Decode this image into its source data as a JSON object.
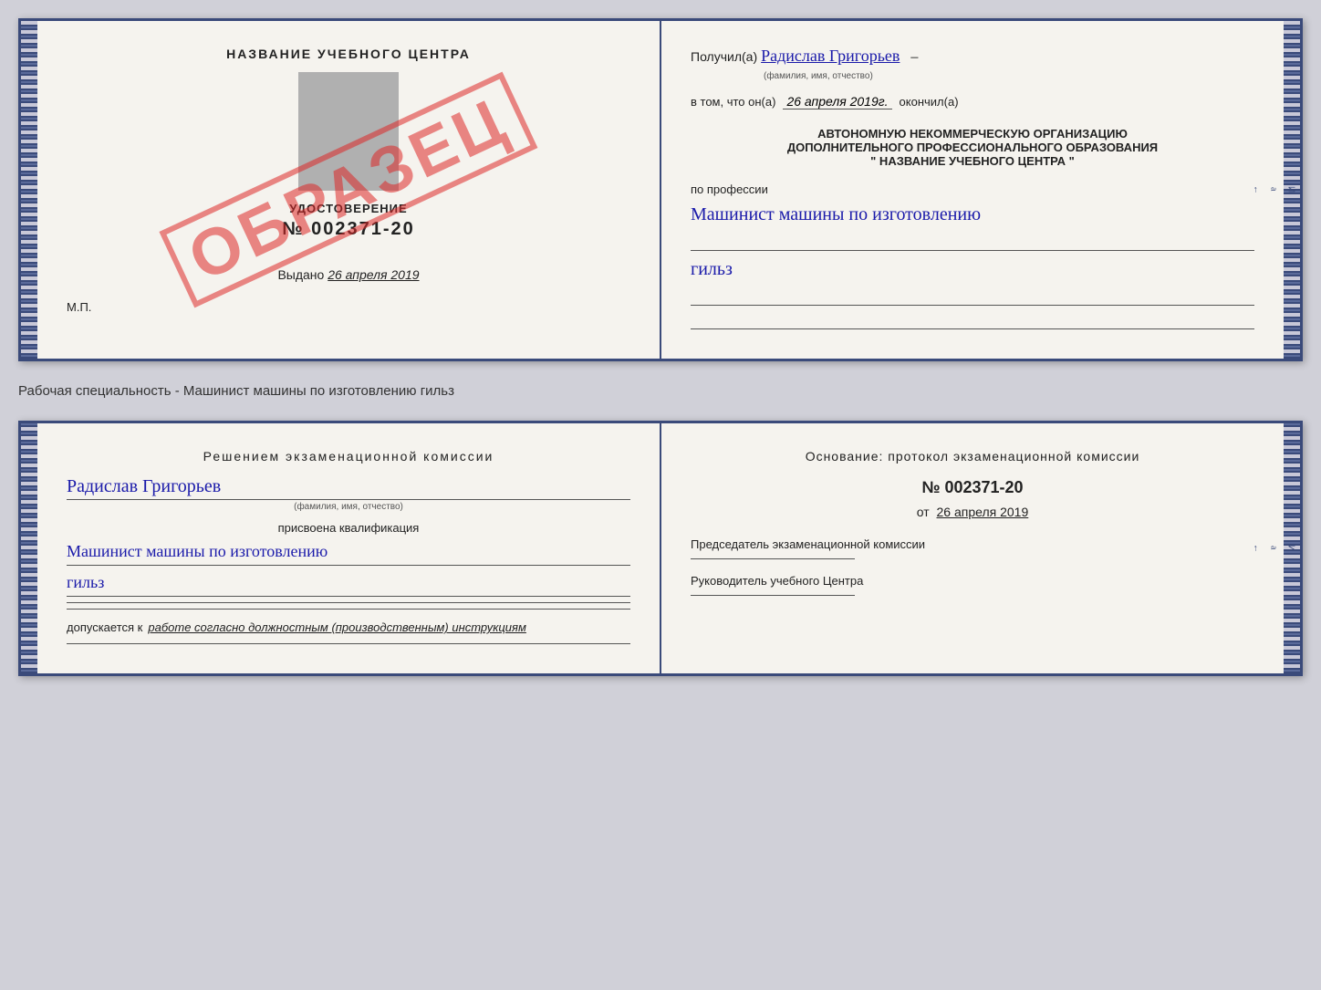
{
  "top_doc": {
    "left": {
      "title": "НАЗВАНИЕ УЧЕБНОГО ЦЕНТРА",
      "cert_label": "УДОСТОВЕРЕНИЕ",
      "cert_number": "№ 002371-20",
      "stamp": "ОБРАЗЕЦ",
      "issued_text": "Выдано",
      "issued_date": "26 апреля 2019",
      "mp_label": "М.П."
    },
    "right": {
      "received_label": "Получил(а)",
      "receiver_name": "Радислав Григорьев",
      "receiver_sub": "(фамилия, имя, отчество)",
      "date_label": "в том, что он(а)",
      "date_value": "26 апреля 2019г.",
      "date_dash": "–",
      "finished_label": "окончил(а)",
      "org_line1": "АВТОНОМНУЮ НЕКОММЕРЧЕСКУЮ ОРГАНИЗАЦИЮ",
      "org_line2": "ДОПОЛНИТЕЛЬНОГО ПРОФЕССИОНАЛЬНОГО ОБРАЗОВАНИЯ",
      "org_line3": "\"    НАЗВАНИЕ УЧЕБНОГО ЦЕНТРА    \"",
      "profession_label": "по профессии",
      "profession_text1": "Машинист машины по изготовлению",
      "profession_text2": "гильз",
      "right_labels": [
        "–",
        "И",
        "а",
        "←",
        "–"
      ]
    }
  },
  "between_label": "Рабочая специальность - Машинист машины по изготовлению гильз",
  "bottom_doc": {
    "left": {
      "decision_text": "Решением  экзаменационной  комиссии",
      "person_name": "Радислав Григорьев",
      "person_sub": "(фамилия, имя, отчество)",
      "qualification_label": "присвоена квалификация",
      "qualification_text1": "Машинист  машины  по  изготовлению",
      "qualification_text2": "гильз",
      "allowed_label": "допускается к",
      "allowed_text": "работе согласно должностным (производственным) инструкциям"
    },
    "right": {
      "basis_label": "Основание:  протокол  экзаменационной  комиссии",
      "protocol_number": "№  002371-20",
      "date_prefix": "от",
      "date_value": "26 апреля 2019",
      "chairman_label": "Председатель экзаменационной комиссии",
      "director_label": "Руководитель учебного Центра",
      "right_labels": [
        "–",
        "–",
        "–",
        "И",
        "а",
        "←",
        "–",
        "–",
        "–"
      ]
    }
  }
}
